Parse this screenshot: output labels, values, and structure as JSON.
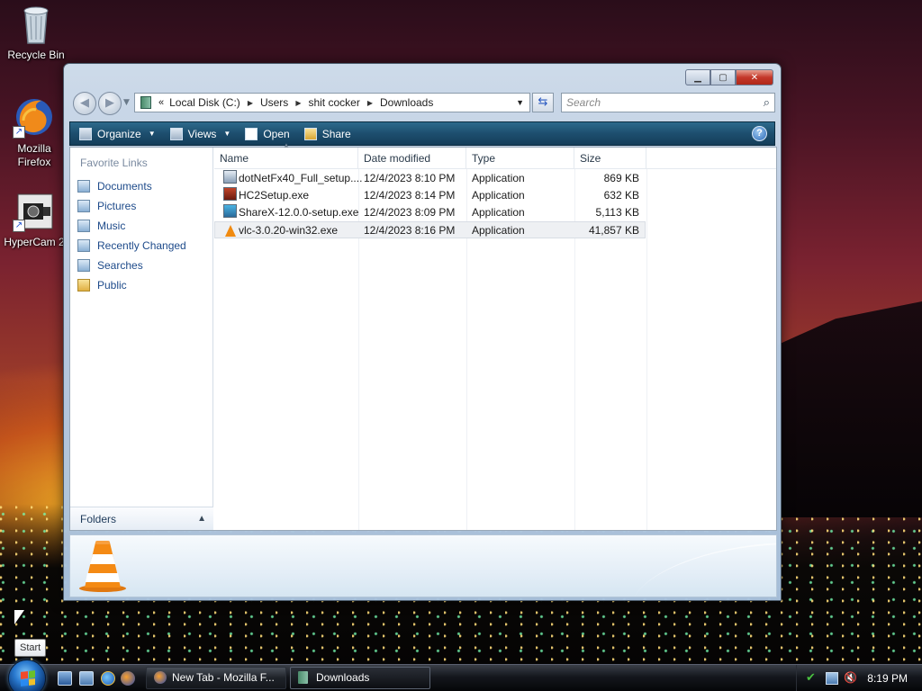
{
  "desktop": {
    "icons": [
      {
        "name": "recycle-bin",
        "label": "Recycle Bin"
      },
      {
        "name": "mozilla-firefox",
        "label_line1": "Mozilla",
        "label_line2": "Firefox"
      },
      {
        "name": "hypercam",
        "label": "HyperCam 2"
      }
    ]
  },
  "explorer": {
    "address": {
      "chevron": "«",
      "crumbs": [
        "Local Disk (C:)",
        "Users",
        "shit cocker",
        "Downloads"
      ]
    },
    "search_placeholder": "Search",
    "toolbar": {
      "organize": "Organize",
      "views": "Views",
      "open": "Open",
      "share": "Share",
      "help": "?"
    },
    "nav_pane": {
      "title": "Favorite Links",
      "links": [
        "Documents",
        "Pictures",
        "Music",
        "Recently Changed",
        "Searches",
        "Public"
      ],
      "folders_label": "Folders"
    },
    "columns": [
      "Name",
      "Date modified",
      "Type",
      "Size"
    ],
    "files": [
      {
        "name": "dotNetFx40_Full_setup....",
        "date": "12/4/2023 8:10 PM",
        "type": "Application",
        "size": "869 KB",
        "icon": "dotnet-setup-icon"
      },
      {
        "name": "HC2Setup.exe",
        "date": "12/4/2023 8:14 PM",
        "type": "Application",
        "size": "632 KB",
        "icon": "hypercam-setup-icon"
      },
      {
        "name": "ShareX-12.0.0-setup.exe",
        "date": "12/4/2023 8:09 PM",
        "type": "Application",
        "size": "5,113 KB",
        "icon": "sharex-setup-icon"
      },
      {
        "name": "vlc-3.0.20-win32.exe",
        "date": "12/4/2023 8:16 PM",
        "type": "Application",
        "size": "41,857 KB",
        "icon": "vlc-cone-icon",
        "selected": true
      }
    ]
  },
  "taskbar": {
    "start_tooltip": "Start",
    "tasks": [
      {
        "label": "New Tab - Mozilla F...",
        "icon": "firefox-icon"
      },
      {
        "label": "Downloads",
        "icon": "folder-icon",
        "active": true
      }
    ],
    "clock": "8:19 PM"
  }
}
